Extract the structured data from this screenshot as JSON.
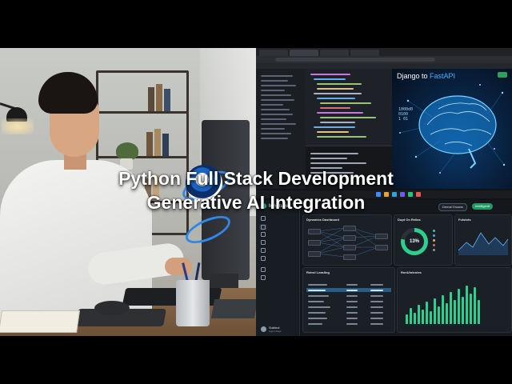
{
  "headline": {
    "line1": "Python Full Stack Development",
    "line2": "Generative AI Integration"
  },
  "brain_panel": {
    "title_prefix": "Django to ",
    "title_accent": "FastAPI",
    "code_snippet": "1000d0\n0100\n1 01"
  },
  "dashboard": {
    "brand": "Innoture",
    "user_name": "Subinol",
    "user_role": "Agent Page",
    "top_buttons": [
      "Demal Groans",
      "Intelligentt"
    ],
    "cards": [
      {
        "title": "Dynamics Dashboard"
      },
      {
        "title": "Dupt On Rellas"
      },
      {
        "title": "Fulstots"
      },
      {
        "title": "Retrol Leasling"
      },
      {
        "title": "RonUlntenles"
      }
    ],
    "donut_label": "13%"
  },
  "colors": {
    "accent_green": "#2ecf8e",
    "brain_blue": "#3fb3ff",
    "primary_btn": "#1f9b63"
  },
  "icons": {
    "brand": "brand-dot-icon",
    "logo": "globe-ring-icon"
  }
}
